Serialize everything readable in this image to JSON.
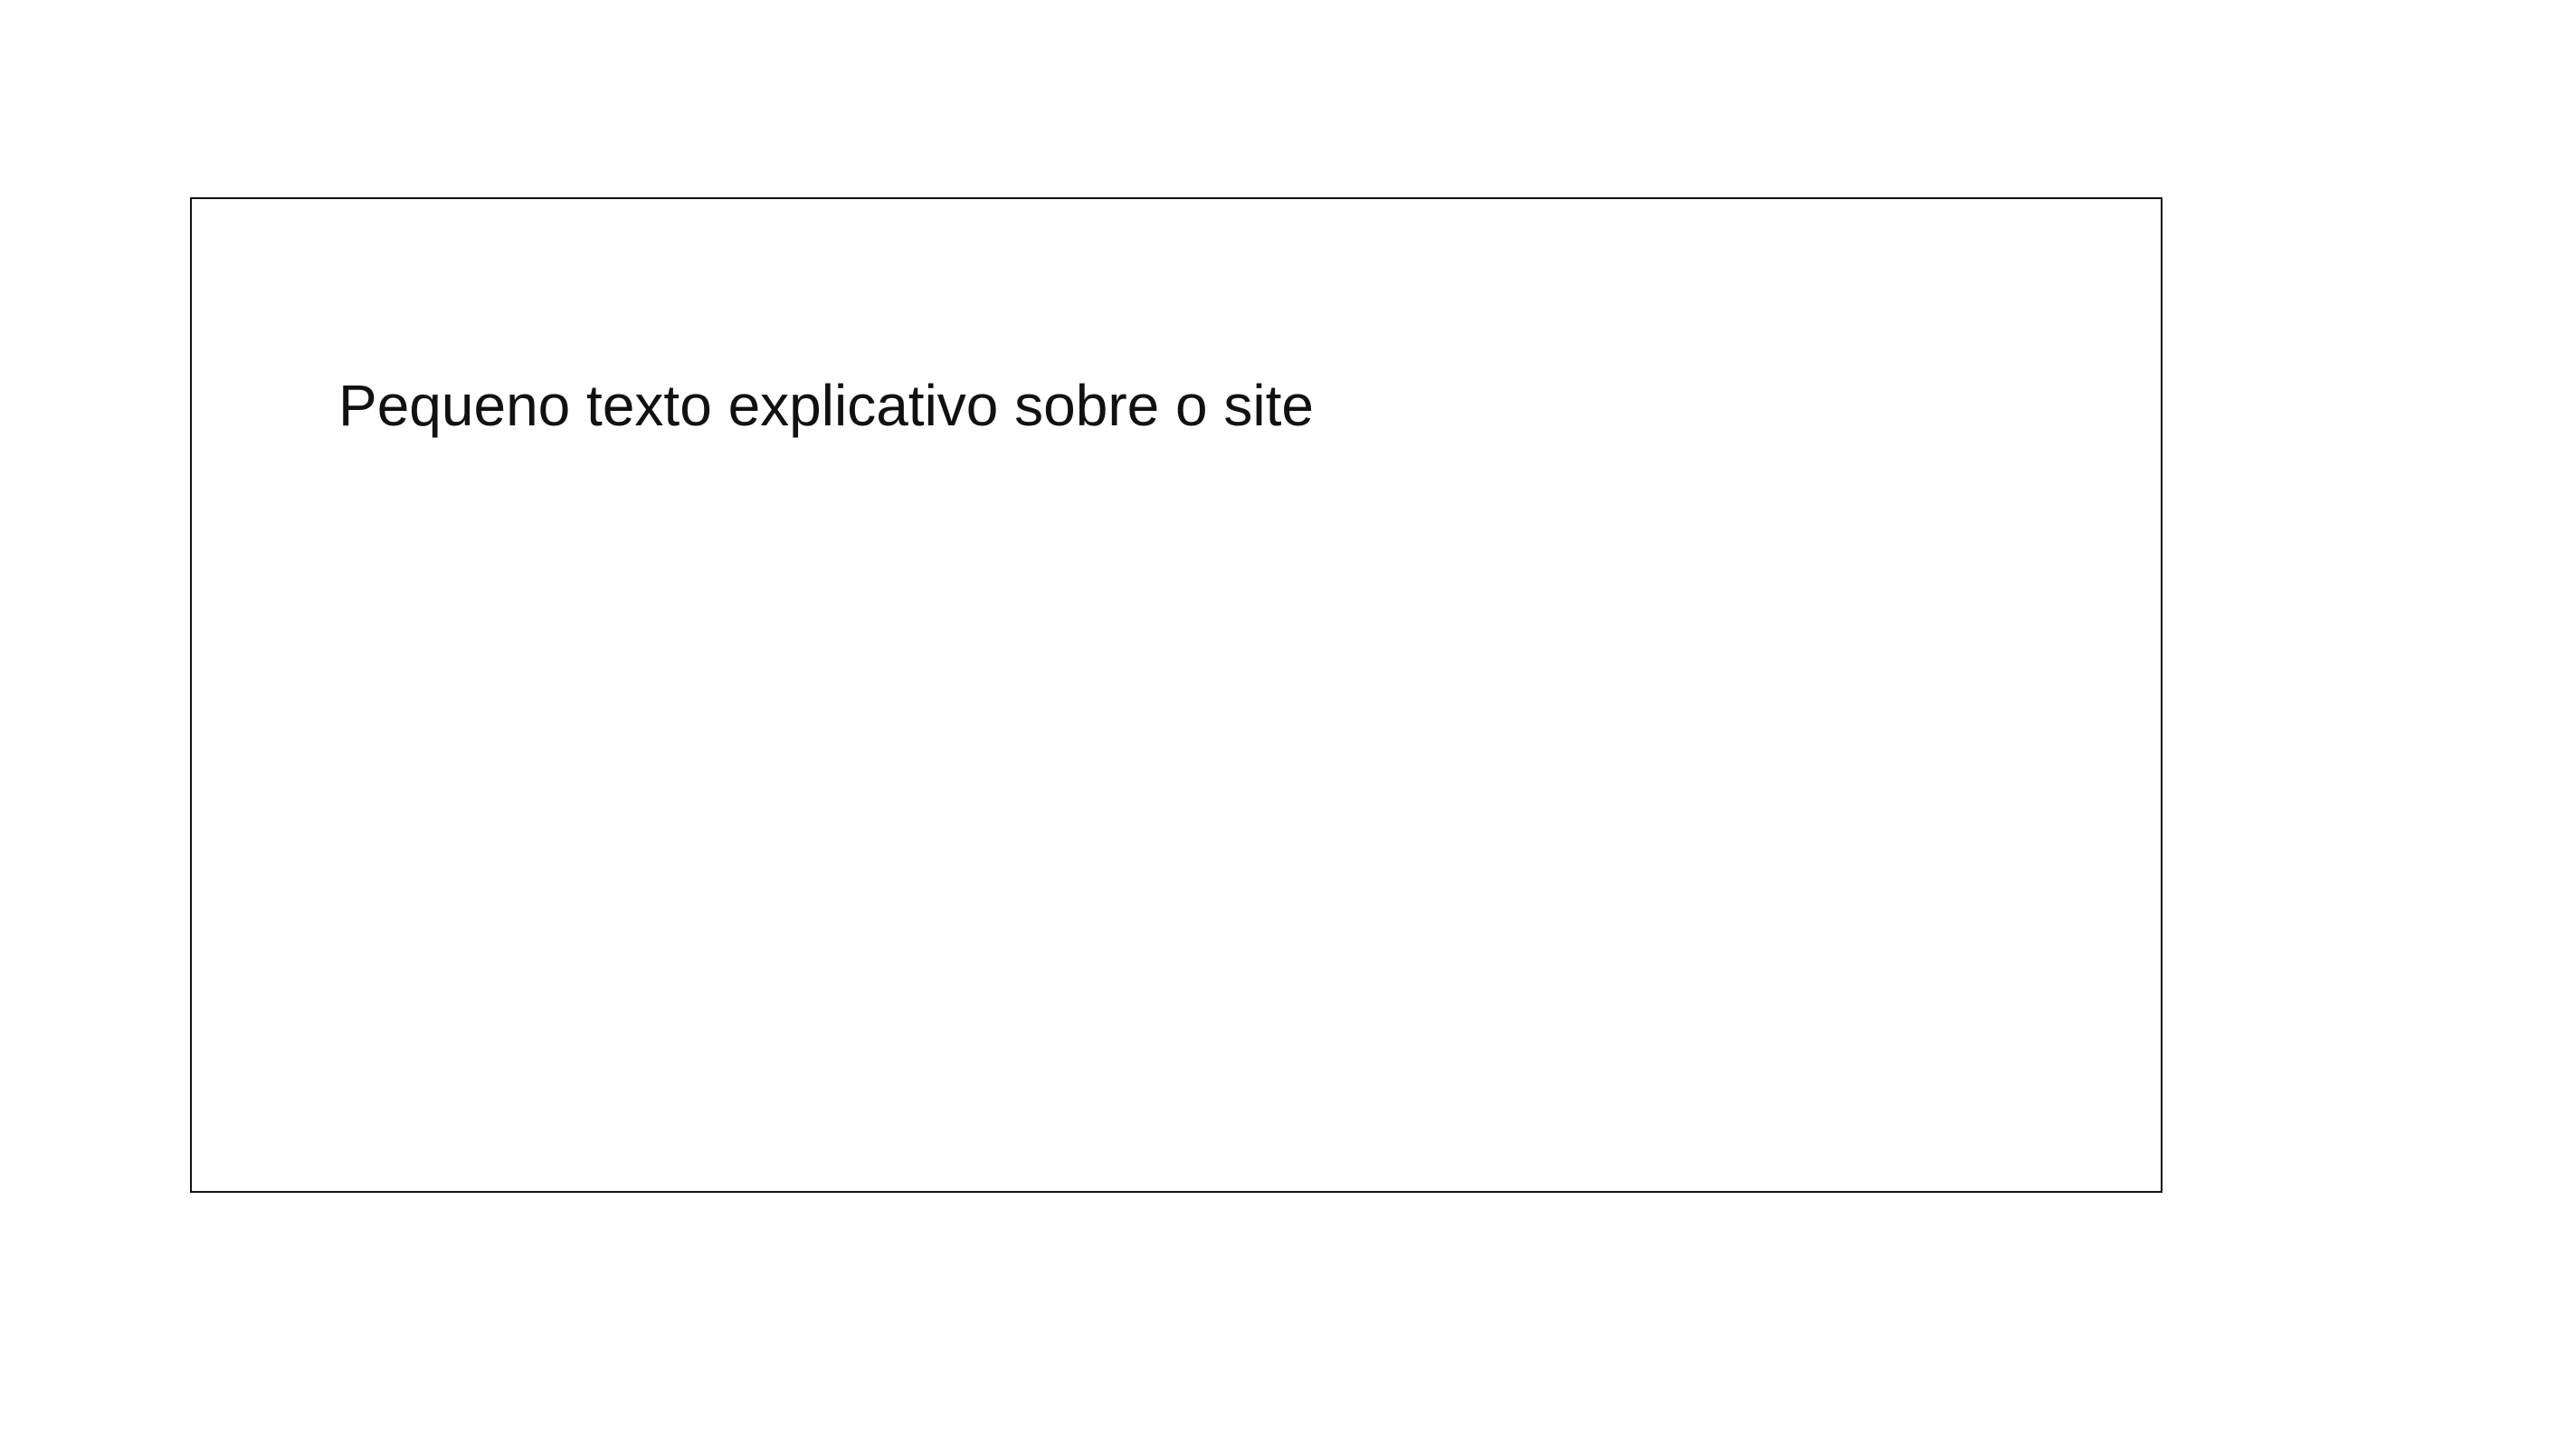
{
  "page": {
    "background": "#ffffff"
  },
  "frame": {
    "border_color": "#111111"
  },
  "content": {
    "intro_text": "Pequeno texto explicativo sobre o site"
  }
}
